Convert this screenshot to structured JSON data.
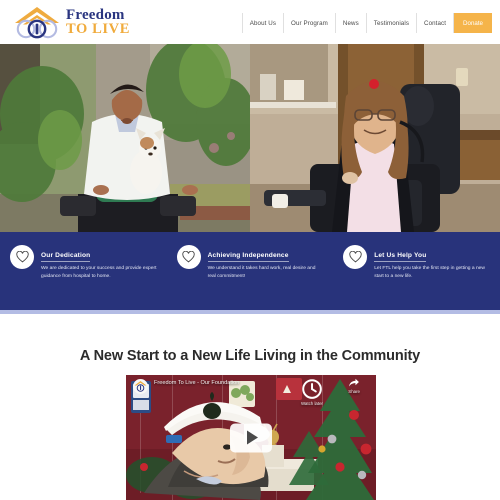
{
  "header": {
    "logo": {
      "line1": "Freedom",
      "line2": "TO LIVE",
      "mark_icon": "house-roof-rings-logo-icon",
      "roof_color": "#efab3f",
      "ring_color": "#2a3580",
      "ring_outer_color": "#b4bbe2"
    },
    "nav": [
      {
        "label": "About Us"
      },
      {
        "label": "Our Program"
      },
      {
        "label": "News"
      },
      {
        "label": "Testimonials"
      },
      {
        "label": "Contact"
      }
    ],
    "donate": {
      "label": "Donate",
      "bg_color": "#f5b44a",
      "text_color": "#ffffff"
    }
  },
  "hero": {
    "slides": [
      {
        "alt": "Smiling man in a power wheelchair holding a small chihuahua dog outdoors in front of a house with green plants"
      },
      {
        "alt": "Smiling woman with glasses in a power wheelchair wearing a pink dress and black cardigan indoors"
      }
    ]
  },
  "band": {
    "bg_color": "#28337b",
    "accent_strip_color": "#b3bce4",
    "features": [
      {
        "icon": "heart-outline-icon",
        "title": "Our Dedication",
        "desc": "We are dedicated to your success and provide expert guidance from hospital to home."
      },
      {
        "icon": "heart-outline-icon",
        "title": "Achieving Independence",
        "desc": "We understand it takes hard work, real desire and real commitment!"
      },
      {
        "icon": "heart-outline-icon",
        "title": "Let Us Help You",
        "desc": "Let FTL help you take the first step in getting a new start to a new life."
      }
    ]
  },
  "main": {
    "headline": "A New Start to a New Life Living in the Community"
  },
  "video": {
    "title": "Freedom To Live - Our Foundation",
    "channel_icon": "channel-avatar-icon",
    "watch_later": {
      "label": "Watch later",
      "icon": "clock-icon"
    },
    "share": {
      "label": "Share",
      "icon": "share-arrow-icon"
    },
    "play_button_icon": "play-triangle-icon",
    "thumbnail_alt": "Man wearing a white baseball cap with a shamrock, speaking, dark red wall and decorated Christmas tree behind him"
  }
}
